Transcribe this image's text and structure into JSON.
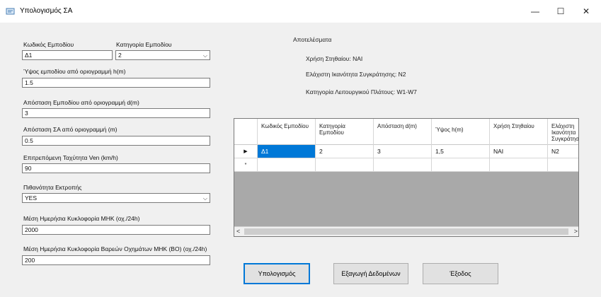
{
  "window": {
    "title": "Υπολογισμός ΣΑ",
    "minimize_glyph": "—",
    "maximize_glyph": "☐",
    "close_glyph": "✕"
  },
  "form": {
    "code_label": "Κωδικός Εμποδίου",
    "code_value": "Δ1",
    "category_label": "Κατηγορία Εμποδίου",
    "category_value": "2",
    "height_label": "Ύψος εμποδίου από οριογραμμή h(m)",
    "height_value": "1.5",
    "distance_label": "Απόσταση Εμποδίου από οριογραμμή d(m)",
    "distance_value": "3",
    "sa_distance_label": "Απόσταση ΣΑ από οριογραμμή (m)",
    "sa_distance_value": "0.5",
    "speed_label": "Επιτρεπόμενη Ταχύτητα Ven (km/h)",
    "speed_value": "90",
    "exit_label": "Πιθανότητα Εκτροπής",
    "exit_value": "YES",
    "traffic_label": "Μέση Ημερήσια Κυκλοφορία ΜΗΚ (οχ./24h)",
    "traffic_value": "2000",
    "heavy_label": "Μέση Ημερήσια Κυκλοφορία Βαρεών Οχημάτων ΜΗΚ (ΒΟ) (οχ./24h)",
    "heavy_value": "200"
  },
  "results": {
    "heading": "Αποτελέσματα",
    "line1": "Χρήση Στηθαίου: ΝΑΙ",
    "line2": "Ελάχιστη Ικανότητα Συγκράτησης: Ν2",
    "line3": "Κατηγορία Λειτουργικού Πλάτους: W1-W7"
  },
  "grid": {
    "headers": [
      "Κωδικός Εμποδίου",
      "Κατηγορία Εμποδίου",
      "Απόσταση d(m)",
      "Ύψος h(m)",
      "Χρήση Στηθαίου",
      "Ελάχιστη Ικανότητα Συγκράτησης"
    ],
    "row": [
      "Δ1",
      "2",
      "3",
      "1,5",
      "ΝΑΙ",
      "N2"
    ],
    "current_row_marker": "▶",
    "new_row_marker": "*",
    "scroll_left": "<",
    "scroll_right": ">"
  },
  "buttons": {
    "calculate": "Υπολογισμός",
    "export": "Εξαγωγή Δεδομένων",
    "exit": "Έξοδος"
  },
  "colors": {
    "selection": "#0078d7",
    "grid_empty_area": "#a9a9a9",
    "window_bg": "#f0f0f0"
  }
}
